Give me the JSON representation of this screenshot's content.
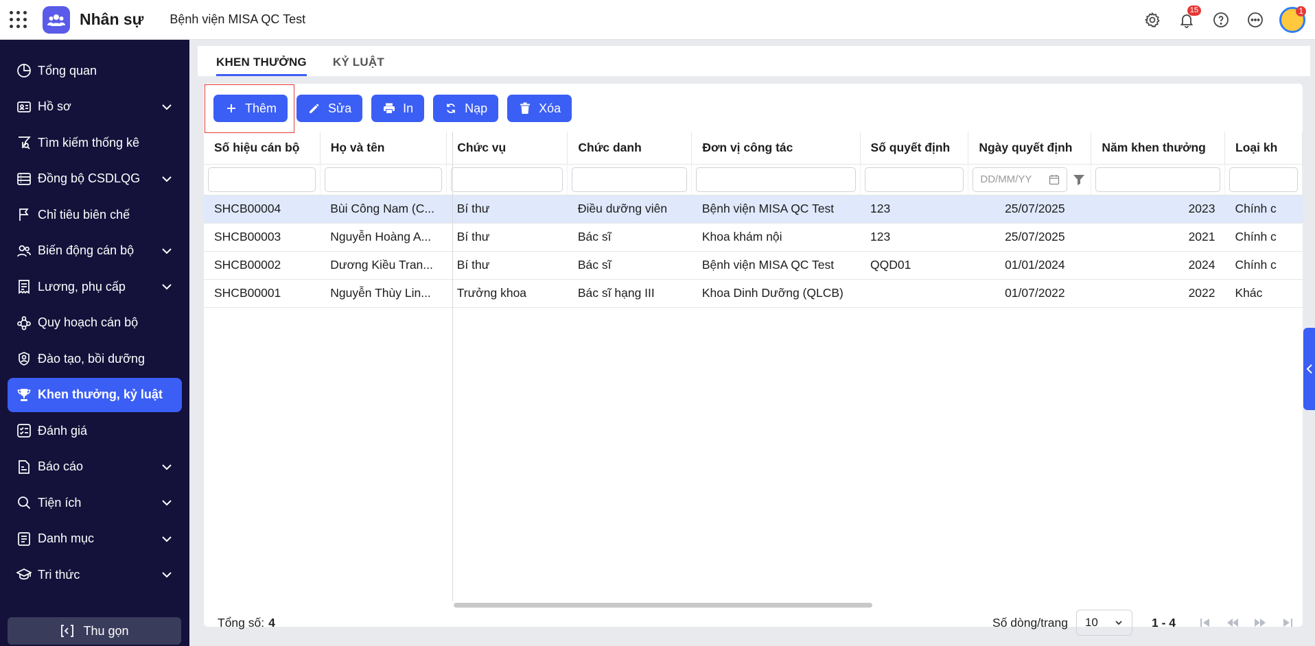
{
  "header": {
    "app_name": "Nhân sự",
    "org_name": "Bệnh viện MISA QC Test",
    "notification_count": "15",
    "avatar_badge": "1"
  },
  "sidebar": {
    "items": [
      {
        "label": "Tổng quan",
        "icon": "pie-chart-icon",
        "expandable": false
      },
      {
        "label": "Hồ sơ",
        "icon": "id-card-icon",
        "expandable": true
      },
      {
        "label": "Tìm kiếm thống kê",
        "icon": "filter-search-icon",
        "expandable": false
      },
      {
        "label": "Đồng bộ CSDLQG",
        "icon": "database-sync-icon",
        "expandable": true
      },
      {
        "label": "Chỉ tiêu biên chế",
        "icon": "flag-icon",
        "expandable": false
      },
      {
        "label": "Biến động cán bộ",
        "icon": "users-icon",
        "expandable": true
      },
      {
        "label": "Lương, phụ cấp",
        "icon": "receipt-icon",
        "expandable": true
      },
      {
        "label": "Quy hoạch cán bộ",
        "icon": "org-chart-icon",
        "expandable": false
      },
      {
        "label": "Đào tạo, bồi dưỡng",
        "icon": "training-icon",
        "expandable": false
      },
      {
        "label": "Khen thưởng, kỷ luật",
        "icon": "trophy-icon",
        "expandable": false
      },
      {
        "label": "Đánh giá",
        "icon": "checklist-icon",
        "expandable": false
      },
      {
        "label": "Báo cáo",
        "icon": "report-icon",
        "expandable": true
      },
      {
        "label": "Tiện ích",
        "icon": "search-icon",
        "expandable": true
      },
      {
        "label": "Danh mục",
        "icon": "list-icon",
        "expandable": true
      },
      {
        "label": "Tri thức",
        "icon": "graduation-cap-icon",
        "expandable": true
      }
    ],
    "active_index": 9,
    "collapse_label": "Thu gọn"
  },
  "tabs": [
    {
      "label": "KHEN THƯỞNG",
      "active": true
    },
    {
      "label": "KỶ LUẬT",
      "active": false
    }
  ],
  "toolbar": {
    "add_label": "Thêm",
    "edit_label": "Sửa",
    "print_label": "In",
    "reload_label": "Nạp",
    "delete_label": "Xóa"
  },
  "table": {
    "columns": [
      "Số hiệu cán bộ",
      "Họ và tên",
      "Chức vụ",
      "Chức danh",
      "Đơn vị công tác",
      "Số quyết định",
      "Ngày quyết định",
      "Năm khen thưởng",
      "Loại kh"
    ],
    "date_placeholder": "DD/MM/YY",
    "rows": [
      [
        "SHCB00004",
        "Bùi Công Nam (C...",
        "Bí thư",
        "Điều dưỡng viên",
        "Bệnh viện MISA QC Test",
        "123",
        "25/07/2025",
        "2023",
        "Chính c"
      ],
      [
        "SHCB00003",
        "Nguyễn Hoàng A...",
        "Bí thư",
        "Bác sĩ",
        "Khoa khám nội",
        "123",
        "25/07/2025",
        "2021",
        "Chính c"
      ],
      [
        "SHCB00002",
        "Dương Kiều Tran...",
        "Bí thư",
        "Bác sĩ",
        "Bệnh viện MISA QC Test",
        "QQD01",
        "01/01/2024",
        "2024",
        "Chính c"
      ],
      [
        "SHCB00001",
        "Nguyễn Thùy Lin...",
        "Trưởng khoa",
        "Bác sĩ hạng III",
        "Khoa Dinh Dưỡng (QLCB)",
        "",
        "01/07/2022",
        "2022",
        "Khác"
      ]
    ],
    "selected_row": 0
  },
  "footer": {
    "total_label": "Tổng số:",
    "total_value": "4",
    "page_size_label": "Số dòng/trang",
    "page_size_value": "10",
    "range": "1 - 4"
  },
  "colors": {
    "primary": "#3b5ef5",
    "sidebar_bg": "#14123a",
    "selected_row": "#dfe9fb",
    "highlight_outline": "#e53935"
  }
}
